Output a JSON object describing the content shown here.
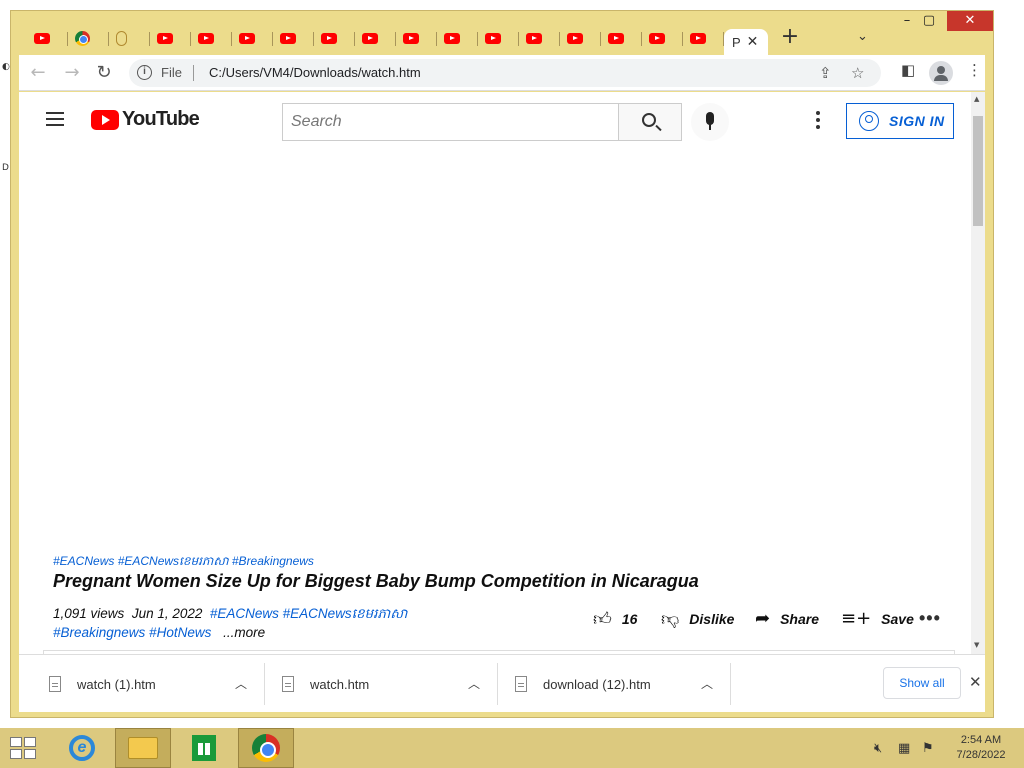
{
  "browser": {
    "active_tab_title": "P",
    "tab_list_icon": "chevron-down-icon",
    "address": {
      "scheme_label": "File",
      "url": "C:/Users/VM4/Downloads/watch.htm"
    }
  },
  "youtube": {
    "logo_text": "YouTube",
    "search_placeholder": "Search",
    "signin_label": "SIGN IN",
    "video": {
      "hashtags": "#EACNews #EACNewsខេមរភាសា #Breakingnews",
      "title": "Pregnant Women Size Up for Biggest Baby Bump Competition in Nicaragua",
      "views": "1,091 views",
      "date": "Jun 1, 2022",
      "desc_tags_line1": "#EACNews #EACNewsខេមរភាសា",
      "desc_tags_line2": "#Breakingnews #HotNews",
      "more_label": "...more",
      "like_count": "16",
      "dislike_label": "Dislike",
      "share_label": "Share",
      "save_label": "Save"
    }
  },
  "downloads": {
    "items": [
      {
        "name": "watch (1).htm"
      },
      {
        "name": "watch.htm"
      },
      {
        "name": "download (12).htm"
      }
    ],
    "show_all_label": "Show all"
  },
  "taskbar": {
    "time": "2:54 AM",
    "date": "7/28/2022"
  },
  "colors": {
    "window_frame": "#ecdc8c",
    "taskbar": "#dcc97f",
    "youtube_red": "#ff0000",
    "link_blue": "#065fd4"
  }
}
